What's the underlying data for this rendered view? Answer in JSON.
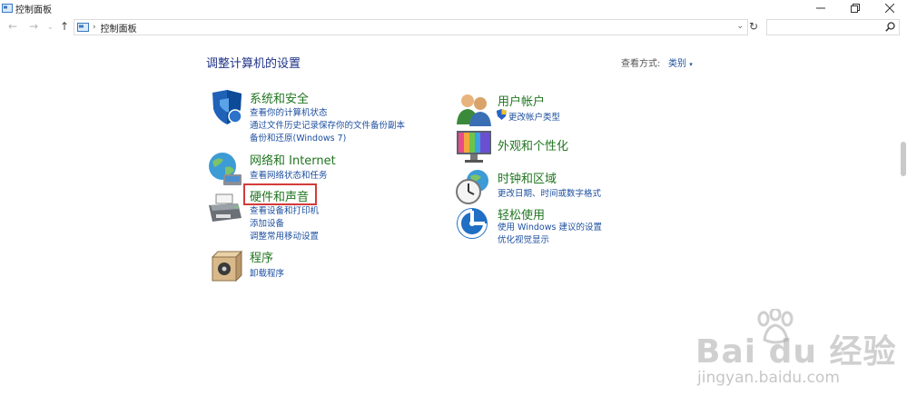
{
  "window": {
    "title": "控制面板"
  },
  "nav": {
    "back_icon": "back-arrow-icon",
    "forward_icon": "forward-arrow-icon",
    "up_icon": "up-arrow-icon"
  },
  "address": {
    "path": "控制面板",
    "separator": "›"
  },
  "search": {
    "placeholder": ""
  },
  "main": {
    "title": "调整计算机的设置",
    "view_by_label": "查看方式:",
    "view_by_value": "类别"
  },
  "categories_left": [
    {
      "title": "系统和安全",
      "icon": "shield-icon",
      "links": [
        "查看你的计算机状态",
        "通过文件历史记录保存你的文件备份副本",
        "备份和还原(Windows 7)"
      ]
    },
    {
      "title": "网络和 Internet",
      "icon": "globe-network-icon",
      "links": [
        "查看网络状态和任务"
      ]
    },
    {
      "title": "硬件和声音",
      "icon": "printer-icon",
      "links": [
        "查看设备和打印机",
        "添加设备",
        "调整常用移动设置"
      ]
    },
    {
      "title": "程序",
      "icon": "programs-icon",
      "links": [
        "卸载程序"
      ]
    }
  ],
  "categories_right": [
    {
      "title": "用户帐户",
      "icon": "users-icon",
      "links": [
        "更改帐户类型"
      ]
    },
    {
      "title": "外观和个性化",
      "icon": "monitor-icon",
      "links": []
    },
    {
      "title": "时钟和区域",
      "icon": "clock-globe-icon",
      "links": [
        "更改日期、时间或数字格式"
      ]
    },
    {
      "title": "轻松使用",
      "icon": "ease-of-access-icon",
      "links": [
        "使用 Windows 建议的设置",
        "优化视觉显示"
      ]
    }
  ],
  "watermark": {
    "brand": "Bai du 经验",
    "url": "jingyan.baidu.com"
  },
  "colors": {
    "link": "#1e50a0",
    "category_title": "#207520",
    "page_title": "#1e3287",
    "highlight": "#d43b3b"
  }
}
